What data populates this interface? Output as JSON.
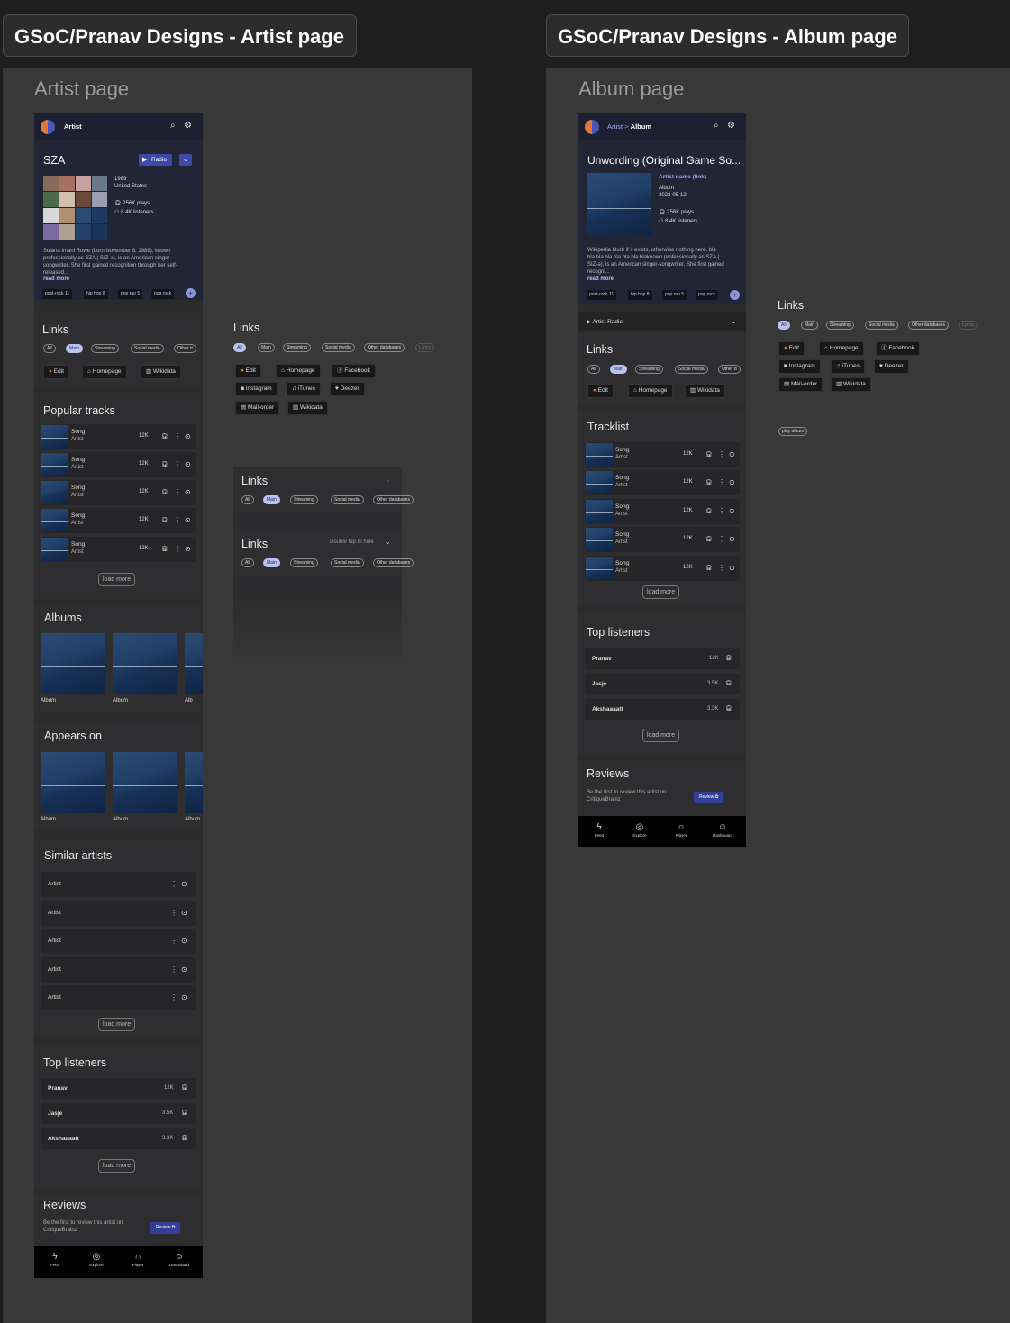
{
  "tabs": {
    "artist": "GSoC/Pranav Designs - Artist page",
    "album": "GSoC/Pranav Designs - Album page"
  },
  "frames": {
    "artist": "Artist page",
    "album": "Album page"
  },
  "artist": {
    "topbar": "Artist",
    "name": "SZA",
    "radio": "Radio",
    "year": "1989",
    "country": "United States",
    "plays": "256K plays",
    "listeners": "8.4K listeners",
    "bio": "Solána Imani Rowe (born November 8, 1989), known professionally as SZA ( SIZ-ə), is an American singer-songwriter. She first gained recognition through her self-released...",
    "read_more": "read more",
    "tags": [
      "post-rock  11",
      "hip hop  8",
      "pop rap  5",
      "pop rock"
    ],
    "links_title": "Links",
    "link_filters": [
      "All",
      "Main",
      "Streaming",
      "Social media",
      "Other d"
    ],
    "link_buttons": [
      "Edit",
      "Homepage",
      "Wikidata"
    ],
    "popular_title": "Popular tracks",
    "tracks": [
      {
        "song": "Song",
        "artist": "Artist",
        "count": "12K"
      },
      {
        "song": "Song",
        "artist": "Artist",
        "count": "12K"
      },
      {
        "song": "Song",
        "artist": "Artist",
        "count": "12K"
      },
      {
        "song": "Song",
        "artist": "Artist",
        "count": "12K"
      },
      {
        "song": "Song",
        "artist": "Artist",
        "count": "12K"
      }
    ],
    "load_more": "load more",
    "albums_title": "Albums",
    "album_labels": [
      "Album",
      "Album",
      "Alb"
    ],
    "appears_title": "Appears on",
    "appears_labels": [
      "Album",
      "Album",
      "Album"
    ],
    "similar_title": "Similar artists",
    "similar": [
      "Artist",
      "Artist",
      "Artist",
      "Artist",
      "Artist"
    ],
    "listeners_title": "Top listeners",
    "listeners_list": [
      {
        "name": "Pranav",
        "count": "12K"
      },
      {
        "name": "Jasje",
        "count": "3.5K"
      },
      {
        "name": "Akshaaaatt",
        "count": "3.3K"
      }
    ],
    "reviews_title": "Reviews",
    "reviews_text": "Be the first to review this artist on CritiqueBrainz",
    "review_btn": "Review",
    "nav": [
      "Feed",
      "Explore",
      "Player",
      "Dashboard"
    ]
  },
  "links_variants": {
    "title": "Links",
    "filters": [
      "All",
      "Main",
      "Streaming",
      "Social media",
      "Other databases",
      "Lyrics"
    ],
    "buttons": [
      "Edit",
      "Homepage",
      "Facebook",
      "Instagram",
      "iTunes",
      "Deezer",
      "Mail-order",
      "Wikidata"
    ],
    "card1_title": "Links",
    "card1_filters": [
      "All",
      "Main",
      "Streaming",
      "Social media",
      "Other databases"
    ],
    "card2_title": "Links",
    "card2_hint": "Double tap to hide",
    "card2_filters": [
      "All",
      "Main",
      "Streaming",
      "Social media",
      "Other databases"
    ]
  },
  "album": {
    "breadcrumb_artist": "Artist",
    "breadcrumb_sep": ">",
    "breadcrumb_album": "Album",
    "name": "Unwording (Original Game So...",
    "artist_link": "Artist name (link)",
    "type": "Album",
    "date": "2023-05-12",
    "plays": "256K plays",
    "listeners": "8.4K listeners",
    "blurb": "Wikipedia blurb if it exists, otherwise nothing here. bla bla bla bla bla bla bla blaknown professionally as SZA ( SIZ-ə), is an American singer-songwriter. She first gained recogni...",
    "read_more": "read more",
    "tags": [
      "post-rock  11",
      "hip hop  8",
      "pop rap  5",
      "pop rock"
    ],
    "artist_radio": "Artist Radio",
    "links_title": "Links",
    "link_filters": [
      "All",
      "Main",
      "Streaming",
      "Social media",
      "Other d"
    ],
    "link_buttons": [
      "Edit",
      "Homepage",
      "Wikidata"
    ],
    "tracklist_title": "Tracklist",
    "tracks": [
      {
        "song": "Song",
        "artist": "Artist",
        "count": "12K"
      },
      {
        "song": "Song",
        "artist": "Artist",
        "count": "12K"
      },
      {
        "song": "Song",
        "artist": "Artist",
        "count": "12K"
      },
      {
        "song": "Song",
        "artist": "Artist",
        "count": "12K"
      },
      {
        "song": "Song",
        "artist": "Artist",
        "count": "12K"
      }
    ],
    "load_more": "load more",
    "listeners_title": "Top listeners",
    "listeners_list": [
      {
        "name": "Pranav",
        "count": "12K"
      },
      {
        "name": "Jasje",
        "count": "3.5K"
      },
      {
        "name": "Akshaaaatt",
        "count": "3.3K"
      }
    ],
    "reviews_title": "Reviews",
    "reviews_text": "Be the first to review this artist on CritiqueBrainz",
    "review_btn": "Review",
    "nav": [
      "Feed",
      "Explore",
      "Player",
      "Dashboard"
    ]
  },
  "album_side": {
    "links_title": "Links",
    "filters": [
      "All",
      "Main",
      "Streaming",
      "Social media",
      "Other databases",
      "Lyrics"
    ],
    "buttons": [
      "Edit",
      "Homepage",
      "Facebook",
      "Instagram",
      "iTunes",
      "Deezer",
      "Mail-order",
      "Wikidata"
    ],
    "play_album": "play album"
  },
  "colors": {
    "accent": "#3d4aa8",
    "pill_on": "#b9c3ee",
    "header": "#1c2030"
  }
}
